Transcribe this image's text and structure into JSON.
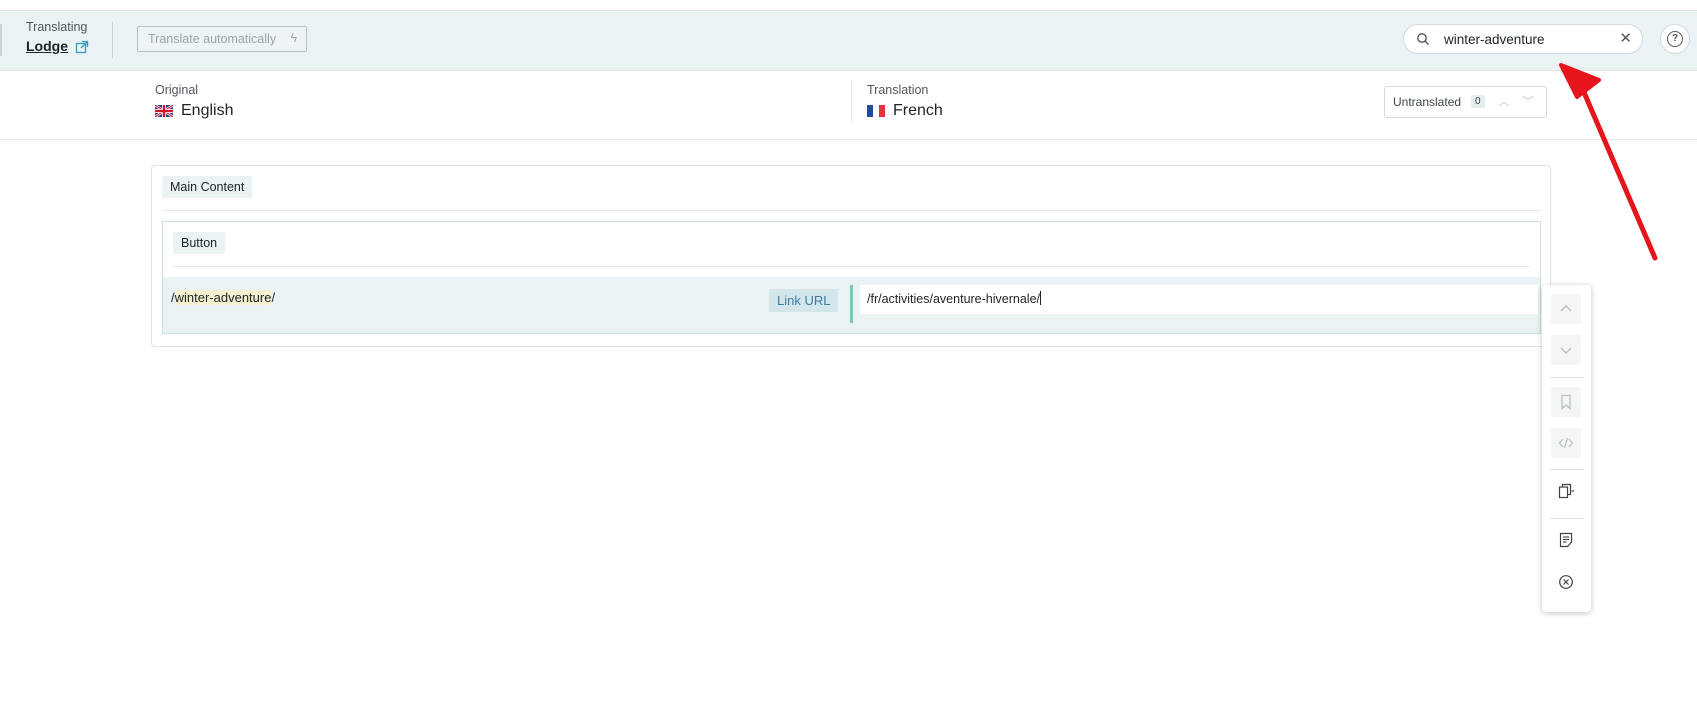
{
  "topbar": {
    "translating_label": "Translating",
    "document_title": "Lodge",
    "translate_auto_label": "Translate automatically",
    "search_value": "winter-adventure",
    "search_placeholder": "Search"
  },
  "languages": {
    "original_label": "Original",
    "original_name": "English",
    "translation_label": "Translation",
    "translation_name": "French"
  },
  "filter": {
    "label": "Untranslated",
    "count": "0"
  },
  "content": {
    "section_label": "Main Content",
    "block_label": "Button",
    "original_prefix": "/",
    "original_highlight": "winter-adventure",
    "original_suffix": "/",
    "field_type": "Link URL",
    "translation_value": "/fr/activities/aventure-hivernale/"
  },
  "toolbar_icons": [
    "chevron-up-icon",
    "chevron-down-icon",
    "bookmark-icon",
    "code-icon",
    "copy-icon",
    "note-icon",
    "close-circle-icon"
  ],
  "colors": {
    "topbar_bg": "#eaf2f4",
    "accent": "#7dc7b6",
    "link_chip_text": "#3a7ea0",
    "highlight": "#f5f0cf",
    "annotation_arrow": "#e8141b"
  }
}
